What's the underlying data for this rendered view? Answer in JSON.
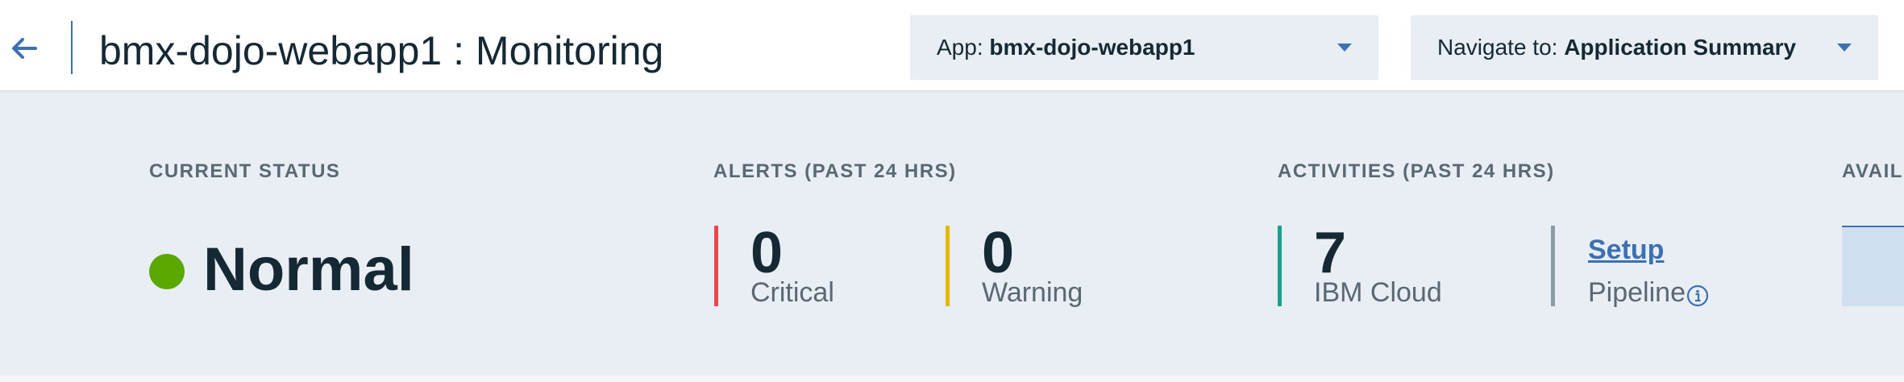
{
  "header": {
    "title": "bmx-dojo-webapp1 : Monitoring",
    "back_icon": "arrow-left-icon",
    "app_dropdown": {
      "label": "App: ",
      "value": "bmx-dojo-webapp1"
    },
    "navigate_dropdown": {
      "label": "Navigate to: ",
      "value": "Application Summary"
    },
    "accent_color": "#3d70b2"
  },
  "summary": {
    "current_status": {
      "heading": "CURRENT STATUS",
      "status": "Normal",
      "status_color": "#5aa700"
    },
    "alerts": {
      "heading": "ALERTS (PAST 24 HRS)",
      "items": [
        {
          "value": "0",
          "label": "Critical",
          "color": "#e8474b"
        },
        {
          "value": "0",
          "label": "Warning",
          "color": "#e6b800"
        }
      ]
    },
    "activities": {
      "heading": "ACTIVITIES (PAST 24 HRS)",
      "items": [
        {
          "value": "7",
          "label": "IBM Cloud",
          "color": "#1aa08a"
        }
      ],
      "pipeline": {
        "link": "Setup",
        "label": "Pipeline",
        "color": "#8c9ba5",
        "info_icon": "info-circle-icon"
      }
    },
    "availability": {
      "heading": "AVAIL"
    }
  }
}
